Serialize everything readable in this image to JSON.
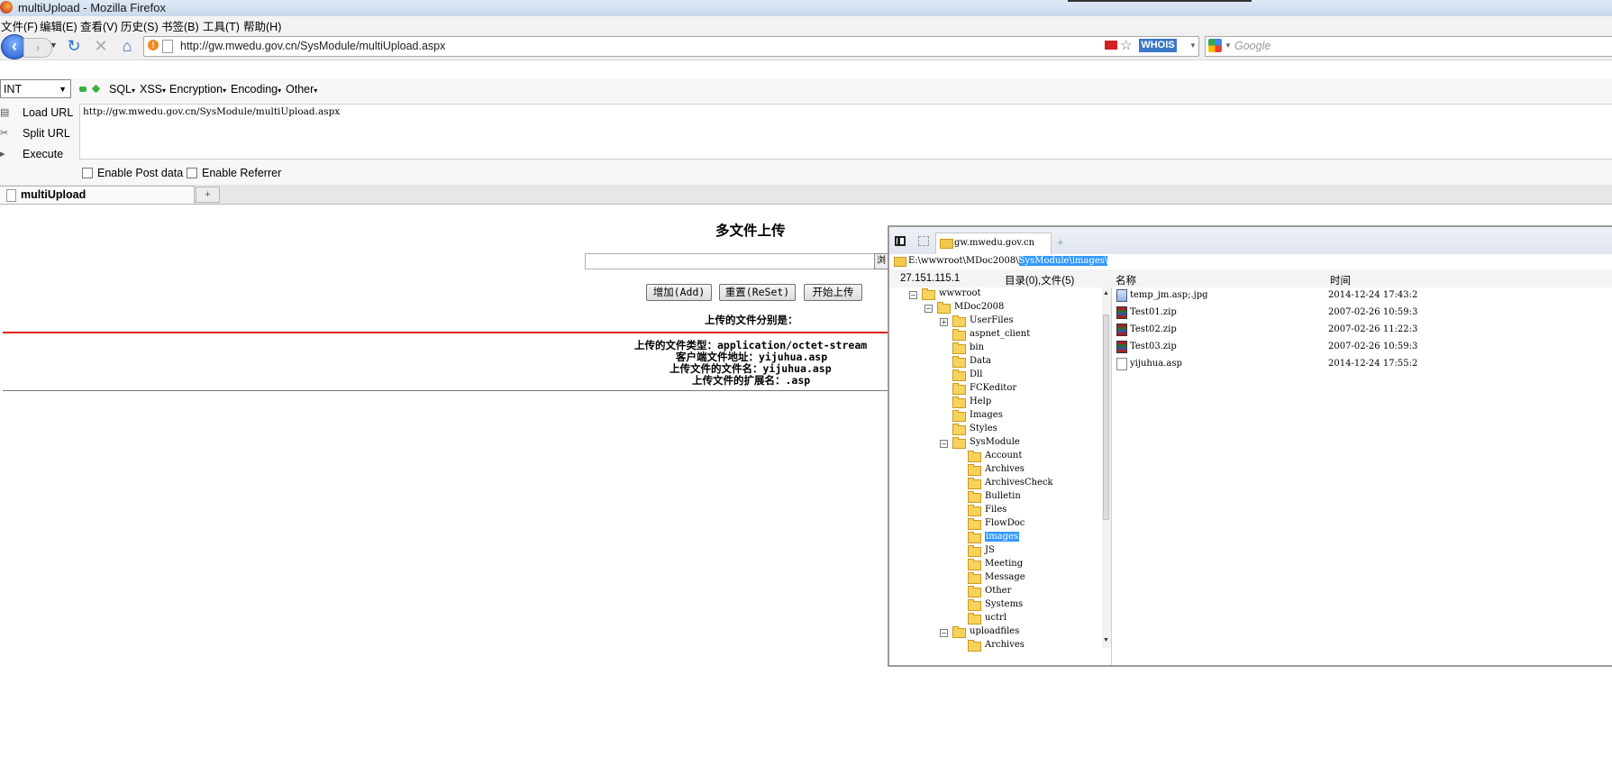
{
  "window": {
    "title": "multiUpload - Mozilla Firefox"
  },
  "menu": [
    "文件(F)",
    "编辑(E)",
    "查看(V)",
    "历史(S)",
    "书签(B)",
    "工具(T)",
    "帮助(H)"
  ],
  "nav": {
    "url": "http://gw.mwedu.gov.cn/SysModule/multiUpload.aspx",
    "whois": "WHOIS",
    "search_placeholder": "Google"
  },
  "hackbar": {
    "select_value": "INT",
    "menus": [
      "SQL",
      "XSS",
      "Encryption",
      "Encoding",
      "Other"
    ],
    "load_url": "Load URL",
    "split_url": "Split URL",
    "execute": "Execute",
    "url_text": "http://gw.mwedu.gov.cn/SysModule/multiUpload.aspx",
    "enable_post": "Enable Post data",
    "enable_referrer": "Enable Referrer"
  },
  "tab": {
    "title": "multiUpload",
    "new_tab": "+"
  },
  "page": {
    "title": "多文件上传",
    "buttons": [
      "增加(Add)",
      "重置(ReSet)",
      "开始上传"
    ],
    "files_label": "上传的文件分别是：",
    "info": [
      "上传的文件类型：application/octet-stream",
      "客户端文件地址：yijuhua.asp",
      "上传文件的文件名：yijuhua.asp",
      "上传文件的扩展名：.asp"
    ]
  },
  "file_manager": {
    "tab_label": "gw.mwedu.gov.cn",
    "path_prefix": "E:\\wwwroot\\MDoc2008\\",
    "path_highlight": "SysModule\\images\\",
    "ip": "27.151.115.1",
    "summary": "目录(0),文件(5)",
    "col_name": "名称",
    "col_time": "时间",
    "tree": [
      {
        "label": "wwwroot",
        "depth": 0,
        "exp": "−"
      },
      {
        "label": "MDoc2008",
        "depth": 1,
        "exp": "−"
      },
      {
        "label": "UserFiles",
        "depth": 2,
        "exp": "+"
      },
      {
        "label": "aspnet_client",
        "depth": 2,
        "exp": ""
      },
      {
        "label": "bin",
        "depth": 2,
        "exp": ""
      },
      {
        "label": "Data",
        "depth": 2,
        "exp": ""
      },
      {
        "label": "Dll",
        "depth": 2,
        "exp": ""
      },
      {
        "label": "FCKeditor",
        "depth": 2,
        "exp": ""
      },
      {
        "label": "Help",
        "depth": 2,
        "exp": ""
      },
      {
        "label": "Images",
        "depth": 2,
        "exp": ""
      },
      {
        "label": "Styles",
        "depth": 2,
        "exp": ""
      },
      {
        "label": "SysModule",
        "depth": 2,
        "exp": "−"
      },
      {
        "label": "Account",
        "depth": 3,
        "exp": ""
      },
      {
        "label": "Archives",
        "depth": 3,
        "exp": ""
      },
      {
        "label": "ArchivesCheck",
        "depth": 3,
        "exp": ""
      },
      {
        "label": "Bulletin",
        "depth": 3,
        "exp": ""
      },
      {
        "label": "Files",
        "depth": 3,
        "exp": ""
      },
      {
        "label": "FlowDoc",
        "depth": 3,
        "exp": ""
      },
      {
        "label": "images",
        "depth": 3,
        "exp": "",
        "selected": true
      },
      {
        "label": "JS",
        "depth": 3,
        "exp": ""
      },
      {
        "label": "Meeting",
        "depth": 3,
        "exp": ""
      },
      {
        "label": "Message",
        "depth": 3,
        "exp": ""
      },
      {
        "label": "Other",
        "depth": 3,
        "exp": ""
      },
      {
        "label": "Systems",
        "depth": 3,
        "exp": ""
      },
      {
        "label": "uctrl",
        "depth": 3,
        "exp": ""
      },
      {
        "label": "uploadfiles",
        "depth": 2,
        "exp": "−"
      },
      {
        "label": "Archives",
        "depth": 3,
        "exp": ""
      }
    ],
    "files": [
      {
        "name": "temp_jm.asp;.jpg",
        "time": "2014-12-24 17:43:2",
        "icon": "img"
      },
      {
        "name": "Test01.zip",
        "time": "2007-02-26 10:59:3",
        "icon": "zip"
      },
      {
        "name": "Test02.zip",
        "time": "2007-02-26 11:22:3",
        "icon": "zip"
      },
      {
        "name": "Test03.zip",
        "time": "2007-02-26 10:59:3",
        "icon": "zip"
      },
      {
        "name": "yijuhua.asp",
        "time": "2014-12-24 17:55:2",
        "icon": "doc"
      }
    ]
  }
}
